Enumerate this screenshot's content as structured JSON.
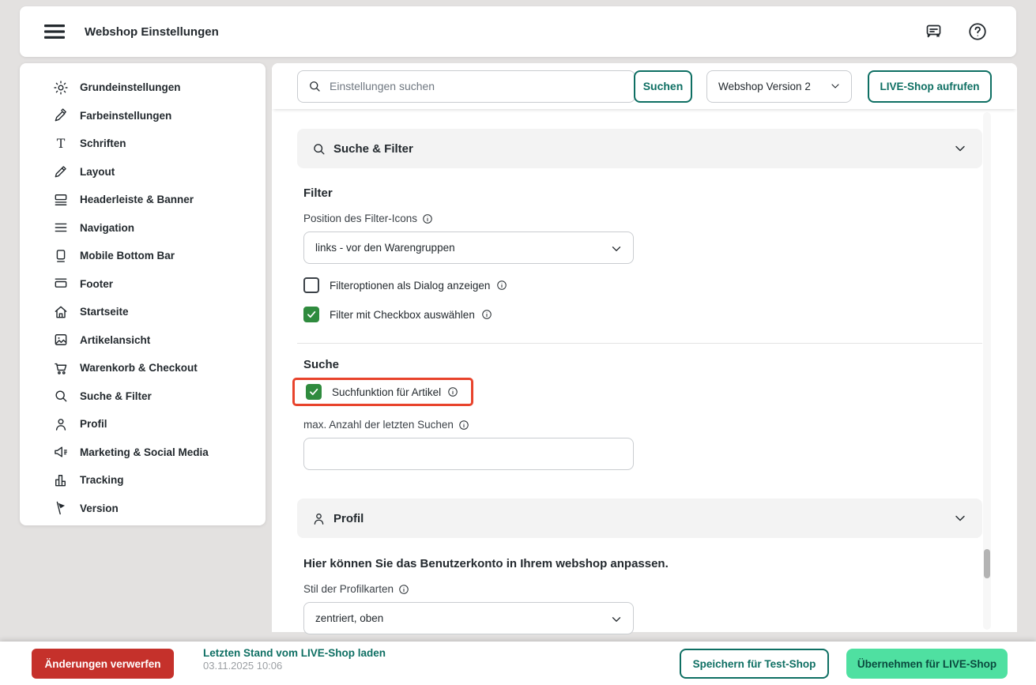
{
  "header": {
    "title": "Webshop Einstellungen"
  },
  "toolbar": {
    "search_placeholder": "Einstellungen suchen",
    "search_button": "Suchen",
    "version_select_value": "Webshop Version 2",
    "live_shop_button": "LIVE-Shop aufrufen"
  },
  "sidebar": {
    "items": [
      {
        "label": "Grundeinstellungen",
        "icon": "gear-icon"
      },
      {
        "label": "Farbeinstellungen",
        "icon": "eyedropper-icon"
      },
      {
        "label": "Schriften",
        "icon": "text-icon"
      },
      {
        "label": "Layout",
        "icon": "pencil-icon"
      },
      {
        "label": "Headerleiste & Banner",
        "icon": "header-icon"
      },
      {
        "label": "Navigation",
        "icon": "menu-lines-icon"
      },
      {
        "label": "Mobile Bottom Bar",
        "icon": "mobile-icon"
      },
      {
        "label": "Footer",
        "icon": "footer-icon"
      },
      {
        "label": "Startseite",
        "icon": "home-icon"
      },
      {
        "label": "Artikelansicht",
        "icon": "image-icon"
      },
      {
        "label": "Warenkorb & Checkout",
        "icon": "cart-icon"
      },
      {
        "label": "Suche & Filter",
        "icon": "search-icon"
      },
      {
        "label": "Profil",
        "icon": "person-icon"
      },
      {
        "label": "Marketing & Social Media",
        "icon": "megaphone-icon"
      },
      {
        "label": "Tracking",
        "icon": "chart-icon"
      },
      {
        "label": "Version",
        "icon": "flag-icon"
      }
    ]
  },
  "sections": {
    "suche_filter": {
      "title": "Suche & Filter",
      "filter": {
        "heading": "Filter",
        "position_label": "Position des Filter-Icons",
        "position_value": "links - vor den Warengruppen",
        "checkbox_dialog_label": "Filteroptionen als Dialog anzeigen",
        "checkbox_dialog_checked": false,
        "checkbox_checkbox_label": "Filter mit Checkbox auswählen",
        "checkbox_checkbox_checked": true
      },
      "suche": {
        "heading": "Suche",
        "checkbox_suchfunktion_label": "Suchfunktion für Artikel",
        "checkbox_suchfunktion_checked": true,
        "checkbox_suchfunktion_highlighted": true,
        "max_label": "max. Anzahl der letzten Suchen",
        "max_value": ""
      }
    },
    "profil": {
      "title": "Profil",
      "description": "Hier können Sie das Benutzerkonto in Ihrem webshop anpassen.",
      "stil_label": "Stil der Profilkarten",
      "stil_value": "zentriert, oben"
    }
  },
  "footer": {
    "discard_button": "Änderungen verwerfen",
    "load_live_link": "Letzten Stand vom LIVE-Shop laden",
    "load_live_timestamp": "03.11.2025 10:06",
    "save_test_button": "Speichern für Test-Shop",
    "apply_live_button": "Übernehmen für LIVE-Shop"
  },
  "colors": {
    "accent_teal": "#0e6f63",
    "mint_green": "#4fe0a1",
    "danger_red": "#c5312b",
    "highlight_red": "#e8432c",
    "checkbox_green": "#2f8b3e",
    "page_background": "#e3e1e0"
  }
}
